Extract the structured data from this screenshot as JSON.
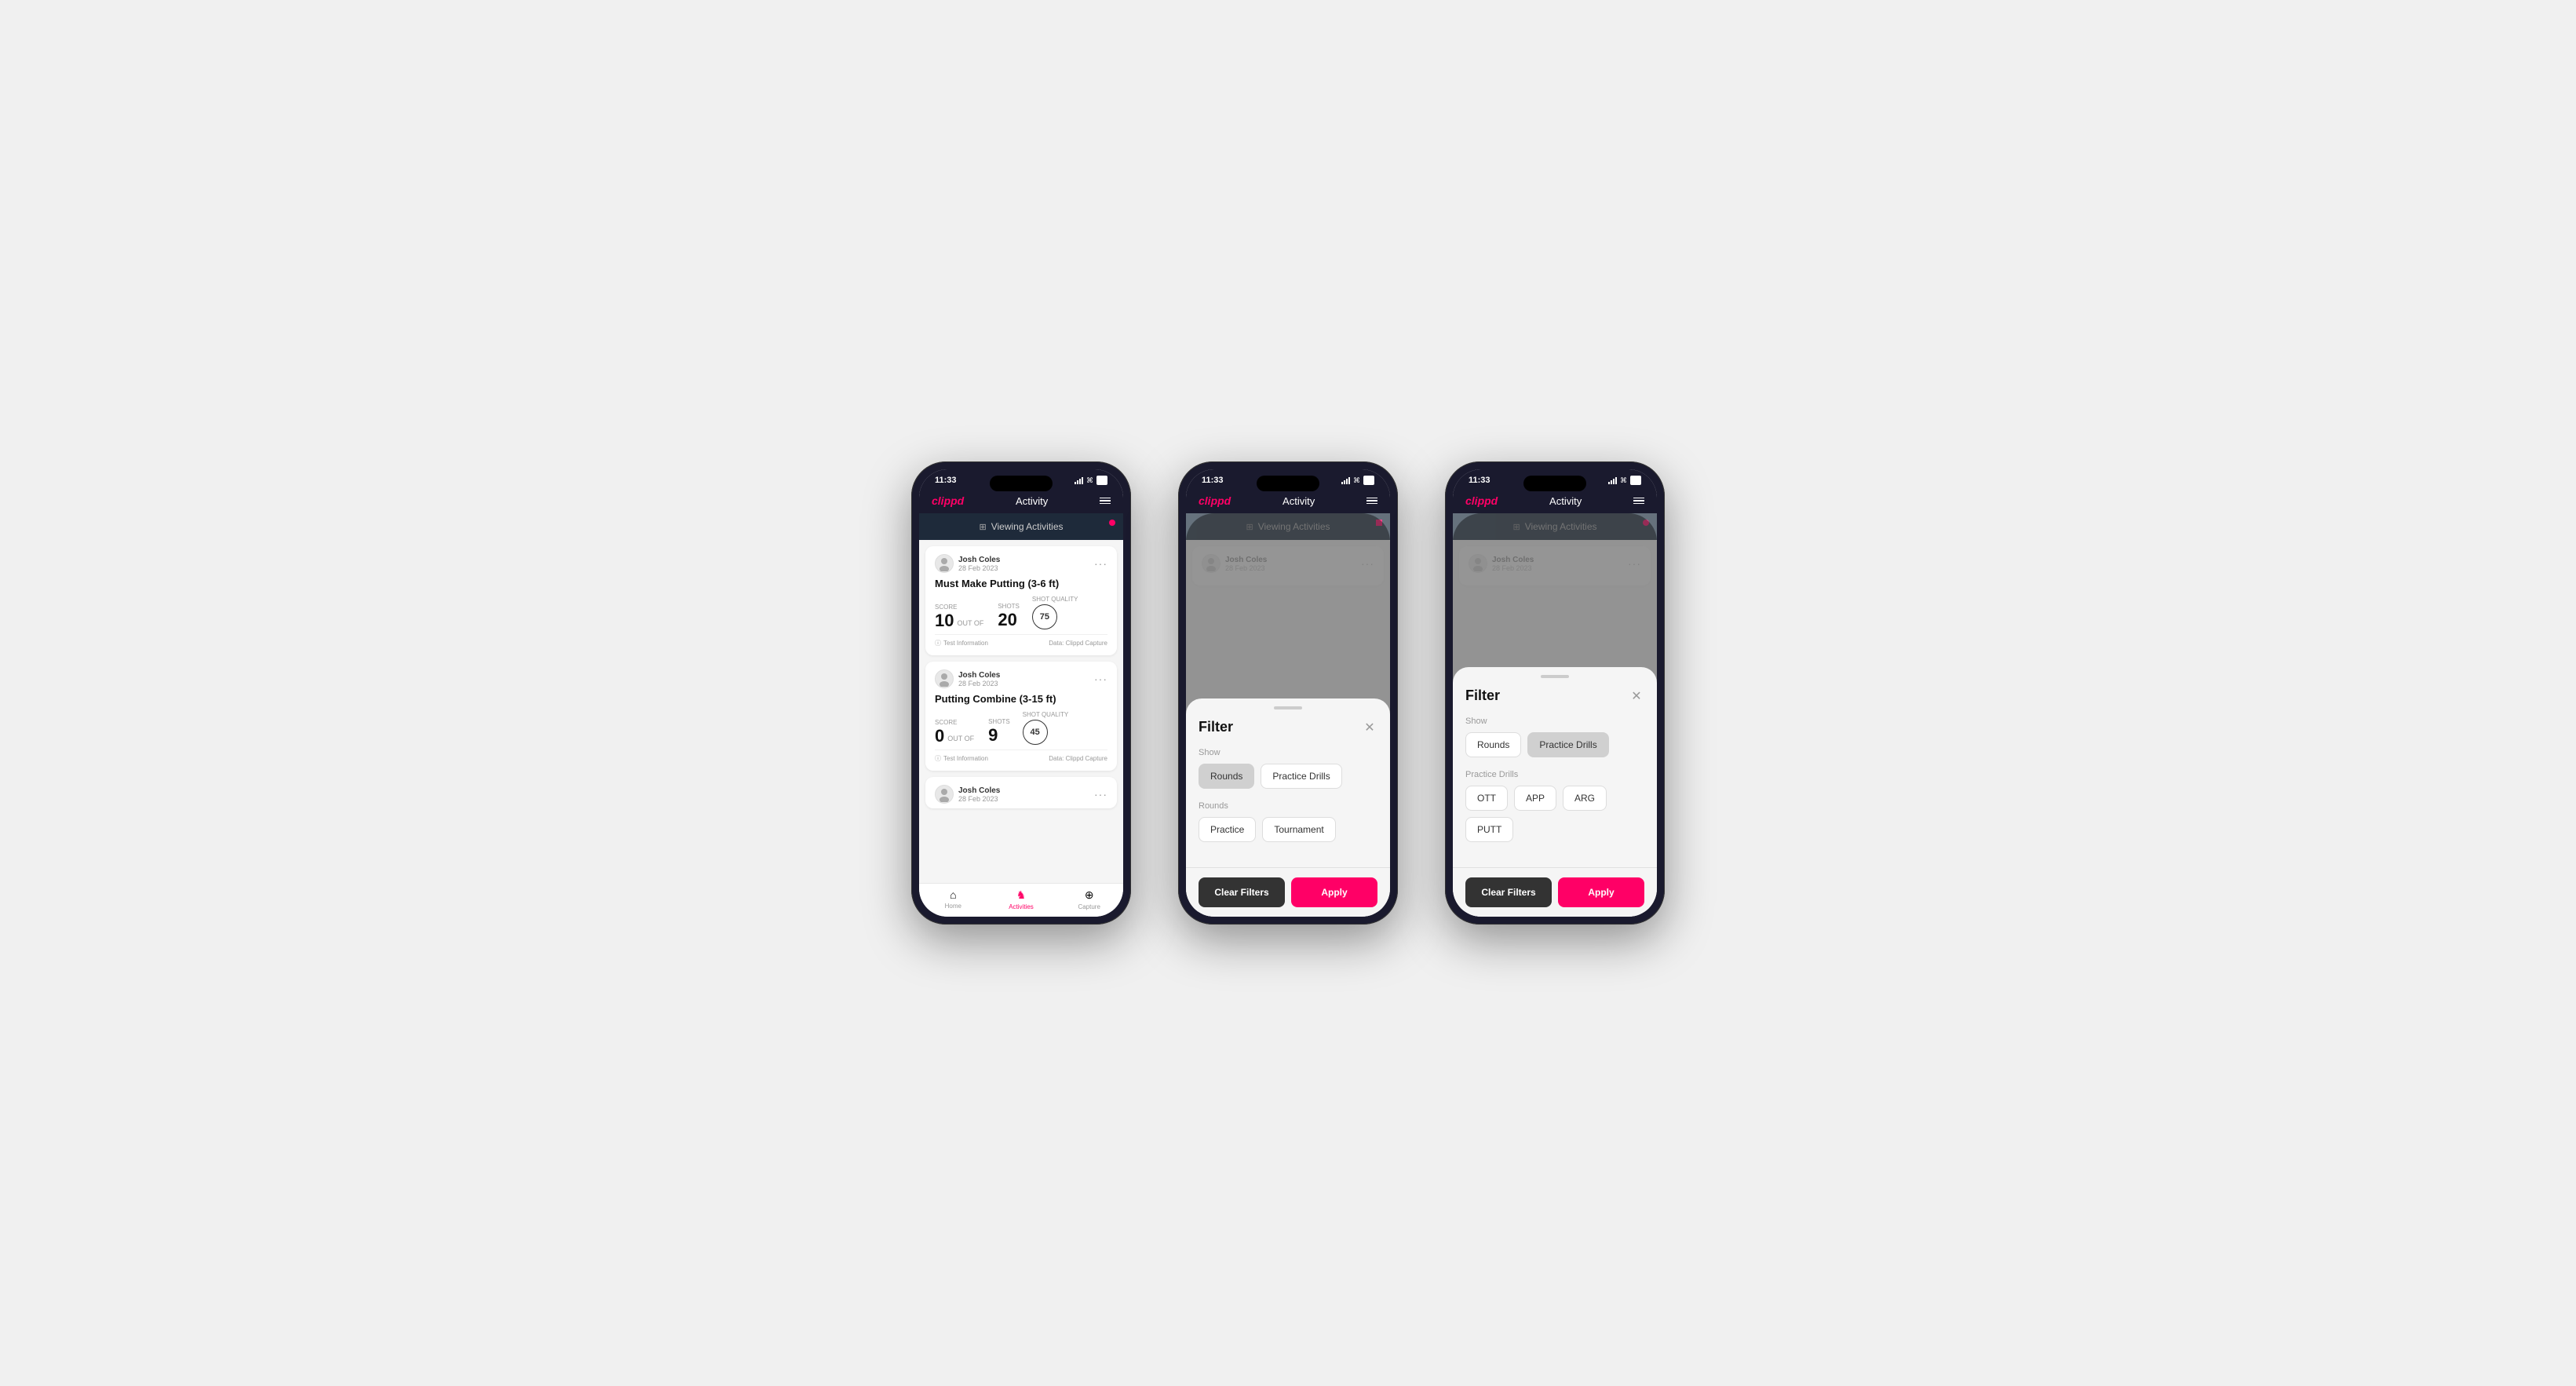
{
  "app": {
    "logo": "clippd",
    "title": "Activity",
    "time": "11:33"
  },
  "viewing_bar": {
    "text": "Viewing Activities",
    "icon": "⊞"
  },
  "nav": {
    "menu_label": "menu"
  },
  "tabs": [
    {
      "id": "home",
      "label": "Home",
      "icon": "⌂",
      "active": false
    },
    {
      "id": "activities",
      "label": "Activities",
      "icon": "♟",
      "active": true
    },
    {
      "id": "capture",
      "label": "Capture",
      "icon": "⊕",
      "active": false
    }
  ],
  "cards": [
    {
      "user": "Josh Coles",
      "date": "28 Feb 2023",
      "title": "Must Make Putting (3-6 ft)",
      "score": "10",
      "out_of": "OUT OF",
      "shots": "20",
      "shot_quality": "75",
      "info": "Test Information",
      "data_source": "Data: Clippd Capture"
    },
    {
      "user": "Josh Coles",
      "date": "28 Feb 2023",
      "title": "Putting Combine (3-15 ft)",
      "score": "0",
      "out_of": "OUT OF",
      "shots": "9",
      "shot_quality": "45",
      "info": "Test Information",
      "data_source": "Data: Clippd Capture"
    },
    {
      "user": "Josh Coles",
      "date": "28 Feb 2023",
      "title": "",
      "score": "",
      "out_of": "",
      "shots": "",
      "shot_quality": "",
      "info": "",
      "data_source": ""
    }
  ],
  "filter_modal_1": {
    "title": "Filter",
    "show_label": "Show",
    "show_buttons": [
      {
        "label": "Rounds",
        "active": true
      },
      {
        "label": "Practice Drills",
        "active": false
      }
    ],
    "rounds_label": "Rounds",
    "rounds_buttons": [
      {
        "label": "Practice",
        "active": false
      },
      {
        "label": "Tournament",
        "active": false
      }
    ],
    "clear_filters": "Clear Filters",
    "apply": "Apply"
  },
  "filter_modal_2": {
    "title": "Filter",
    "show_label": "Show",
    "show_buttons": [
      {
        "label": "Rounds",
        "active": false
      },
      {
        "label": "Practice Drills",
        "active": true
      }
    ],
    "drills_label": "Practice Drills",
    "drills_buttons": [
      {
        "label": "OTT",
        "active": false
      },
      {
        "label": "APP",
        "active": false
      },
      {
        "label": "ARG",
        "active": false
      },
      {
        "label": "PUTT",
        "active": false
      }
    ],
    "clear_filters": "Clear Filters",
    "apply": "Apply"
  },
  "stat_labels": {
    "score": "Score",
    "shots": "Shots",
    "shot_quality": "Shot Quality"
  }
}
